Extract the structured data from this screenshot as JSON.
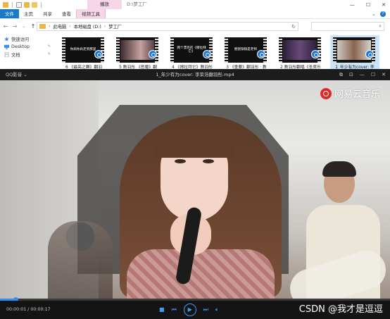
{
  "explorer": {
    "title": "D:\\梦工厂",
    "context_tab": "播放",
    "ribbon_tabs": [
      "文件",
      "主页",
      "共享",
      "查看",
      "视频工具"
    ],
    "breadcrumb": [
      "此电脑",
      "本地磁盘 (D:)",
      "梦工厂"
    ],
    "search_placeholder": "",
    "nav_items": [
      {
        "label": "快速访问",
        "icon": "star-icon"
      },
      {
        "label": "Desktop",
        "icon": "desktop-icon"
      },
      {
        "label": "文档",
        "icon": "document-icon"
      }
    ],
    "thumbnails": [
      {
        "caption": "你肩你肩走到那里",
        "label": "6 《最亮之舞》翻羽"
      },
      {
        "caption": "",
        "label": "5 教羽彤 《恶魔》翻"
      },
      {
        "caption": "两个漂亮的《擦拉拜它》",
        "label": "4 《擦拉拜它》教羽彤"
      },
      {
        "caption": "鲍锐锅锅是老师",
        "label": "3 《重要》翻羽彤 · 教"
      },
      {
        "caption": "",
        "label": "2 教羽彤翻唱《圣席乐"
      },
      {
        "caption": "",
        "label": "1_年少有为cover: 李"
      }
    ],
    "accent": "#1979ca",
    "context_color": "#f7d6ea"
  },
  "player": {
    "app_name": "QQ影音",
    "file_name": "1_年少有为cover: 李荣浩翻羽彤.mp4",
    "watermark": "网易云音乐",
    "time_current": "00:00:01",
    "time_total": "00:00:17",
    "progress_fraction": 0.04,
    "accent": "#3d9df5",
    "overlay_text": "CSDN @我才是逗逗"
  }
}
